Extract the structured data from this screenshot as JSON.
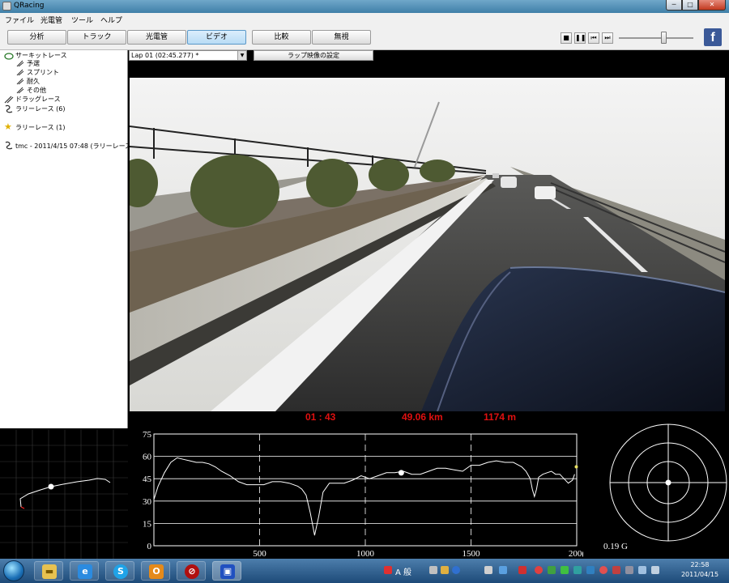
{
  "window": {
    "title": "QRacing",
    "min_glyph": "─",
    "max_glyph": "□",
    "close_glyph": "✕"
  },
  "menu": [
    "ファイル",
    "光電管",
    "ツール",
    "ヘルプ"
  ],
  "tabs": [
    {
      "label": "分析",
      "active": false
    },
    {
      "label": "トラック",
      "active": false
    },
    {
      "label": "光電管",
      "active": false
    },
    {
      "label": "ビデオ",
      "active": true
    },
    {
      "label": "比較",
      "active": false
    },
    {
      "label": "無視",
      "active": false
    }
  ],
  "playback": {
    "stop": "■",
    "pause": "❚❚",
    "prev": "⏮",
    "next": "⏭"
  },
  "facebook": {
    "glyph": "f"
  },
  "tree": {
    "circuit": "サーキットレース",
    "qualify": "予選",
    "sprint": "スプリント",
    "endurance": "耐久",
    "other": "その他",
    "drag": "ドラッグレース",
    "rally": "ラリーレース (6)",
    "rally_fav": "ラリーレース (1)",
    "session": "tmc - 2011/4/15 07:48 (ラリーレース)"
  },
  "lap_select": {
    "value": "Lap 01  (02:45.277) *"
  },
  "lap_video_button": "ラップ映像の設定",
  "overlay": {
    "time": "01 : 43",
    "distance": "49.06 km",
    "position": "1174 m"
  },
  "chart_data": {
    "type": "line",
    "title": "",
    "xlabel": "",
    "ylabel": "",
    "xlim": [
      0,
      2000
    ],
    "ylim": [
      0,
      75
    ],
    "xticks": [
      500,
      1000,
      1500,
      2000
    ],
    "xtick_labels": [
      "500",
      "1000",
      "1500",
      "200("
    ],
    "yticks": [
      0,
      15,
      30,
      45,
      60,
      75
    ],
    "grid": true,
    "series": [
      {
        "x": [
          0,
          20,
          50,
          80,
          110,
          140,
          170,
          200,
          230,
          260,
          290,
          320,
          360,
          400,
          440,
          480,
          520,
          560,
          600,
          640,
          680,
          700,
          720,
          740,
          760,
          780,
          800,
          830,
          860,
          900,
          940,
          980,
          1020,
          1060,
          1100,
          1140,
          1180,
          1220,
          1260,
          1300,
          1340,
          1380,
          1420,
          1460,
          1500,
          1540,
          1580,
          1620,
          1660,
          1700,
          1740,
          1760,
          1780,
          1790,
          1800,
          1810,
          1820,
          1840,
          1860,
          1880,
          1900,
          1920,
          1940,
          1960,
          1980,
          1990
        ],
        "values": [
          31,
          40,
          49,
          56,
          59,
          58,
          57,
          56,
          56,
          55,
          53,
          50,
          47,
          43,
          41,
          41,
          41,
          43,
          43,
          42,
          40,
          38,
          34,
          22,
          7,
          20,
          36,
          42,
          42,
          42,
          44,
          47,
          45,
          47,
          49,
          49,
          50,
          48,
          48,
          50,
          52,
          52,
          51,
          50,
          54,
          54,
          56,
          57,
          56,
          56,
          53,
          50,
          45,
          38,
          33,
          38,
          46,
          48,
          49,
          50,
          48,
          48,
          45,
          42,
          44,
          48
        ]
      }
    ],
    "marker": {
      "x": 1170,
      "y": 49
    },
    "end_marker": {
      "x": 1998,
      "y": 53
    }
  },
  "gmeter": {
    "value": "0.19 G",
    "gx": 0.0,
    "gy": 0.0
  },
  "colors": {
    "overlay_red": "#e01010",
    "trace": "#ffffff",
    "grid": "#ffffff",
    "fb_blue": "#3b5998"
  },
  "taskbar": {
    "apps": [
      "folder",
      "ie",
      "skype",
      "outlook",
      "ban",
      "qracing"
    ],
    "time": "22:58",
    "date": "2011/04/15",
    "ime": "A 般"
  }
}
